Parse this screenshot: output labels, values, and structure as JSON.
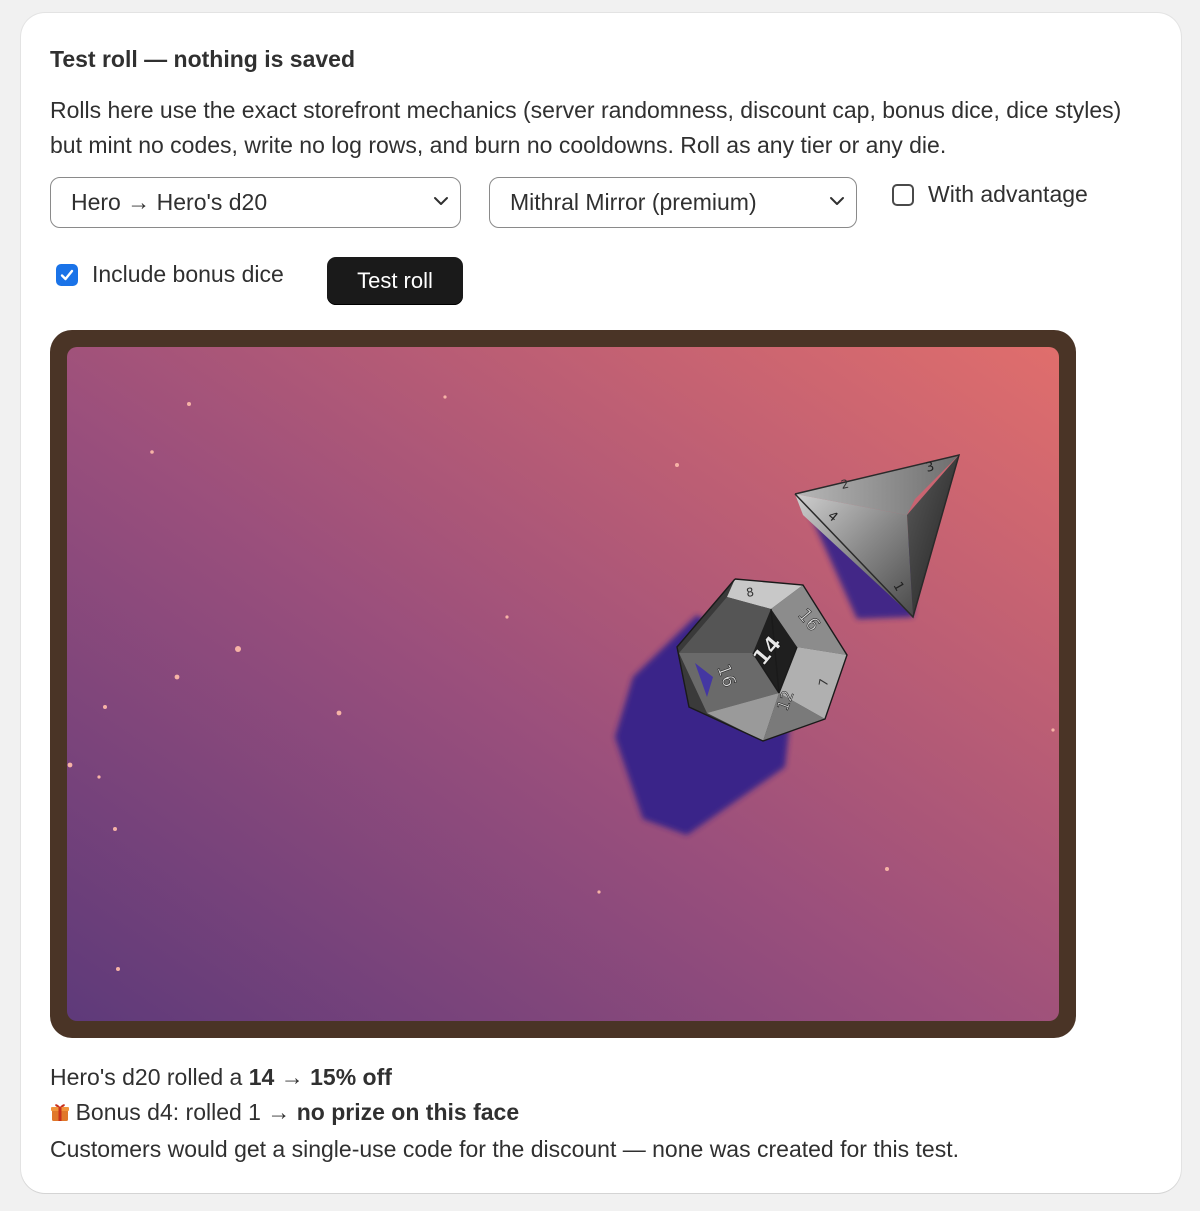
{
  "panel": {
    "title": "Test roll — nothing is saved",
    "description": "Rolls here use the exact storefront mechanics (server randomness, discount cap, bonus dice, dice styles) but mint no codes, write no log rows, and burn no cooldowns. Roll as any tier or any die."
  },
  "controls": {
    "tier_select": {
      "value": "Hero → Hero's d20"
    },
    "style_select": {
      "value": "Mithral Mirror (premium)"
    },
    "advantage": {
      "label": "With advantage",
      "checked": false
    },
    "bonus_dice": {
      "label": "Include bonus dice",
      "checked": true
    },
    "test_roll_label": "Test roll"
  },
  "colors": {
    "bg_gradient_top_right": "#e06e6c",
    "bg_gradient_bottom_left": "#5e3a7a",
    "frame": "#4a3426",
    "dice_shadow": "#35248a",
    "checkbox_accent": "#1a73e8",
    "button": "#1a1a1a"
  },
  "dice": {
    "main": {
      "type": "d20",
      "faces_visible": [
        "16",
        "14",
        "16",
        "12",
        "8",
        "7"
      ]
    },
    "bonus": {
      "type": "d4",
      "faces_visible": [
        "3",
        "2",
        "1",
        "4"
      ]
    }
  },
  "result": {
    "main_prefix": "Hero's d20 rolled a ",
    "main_roll": "14",
    "arrow": " → ",
    "main_prize": "15% off",
    "bonus_icon": "gift-icon",
    "bonus_prefix": " Bonus d4: rolled 1 → ",
    "bonus_prize": "no prize on this face",
    "note": "Customers would get a single-use code for the discount — none was created for this test."
  }
}
